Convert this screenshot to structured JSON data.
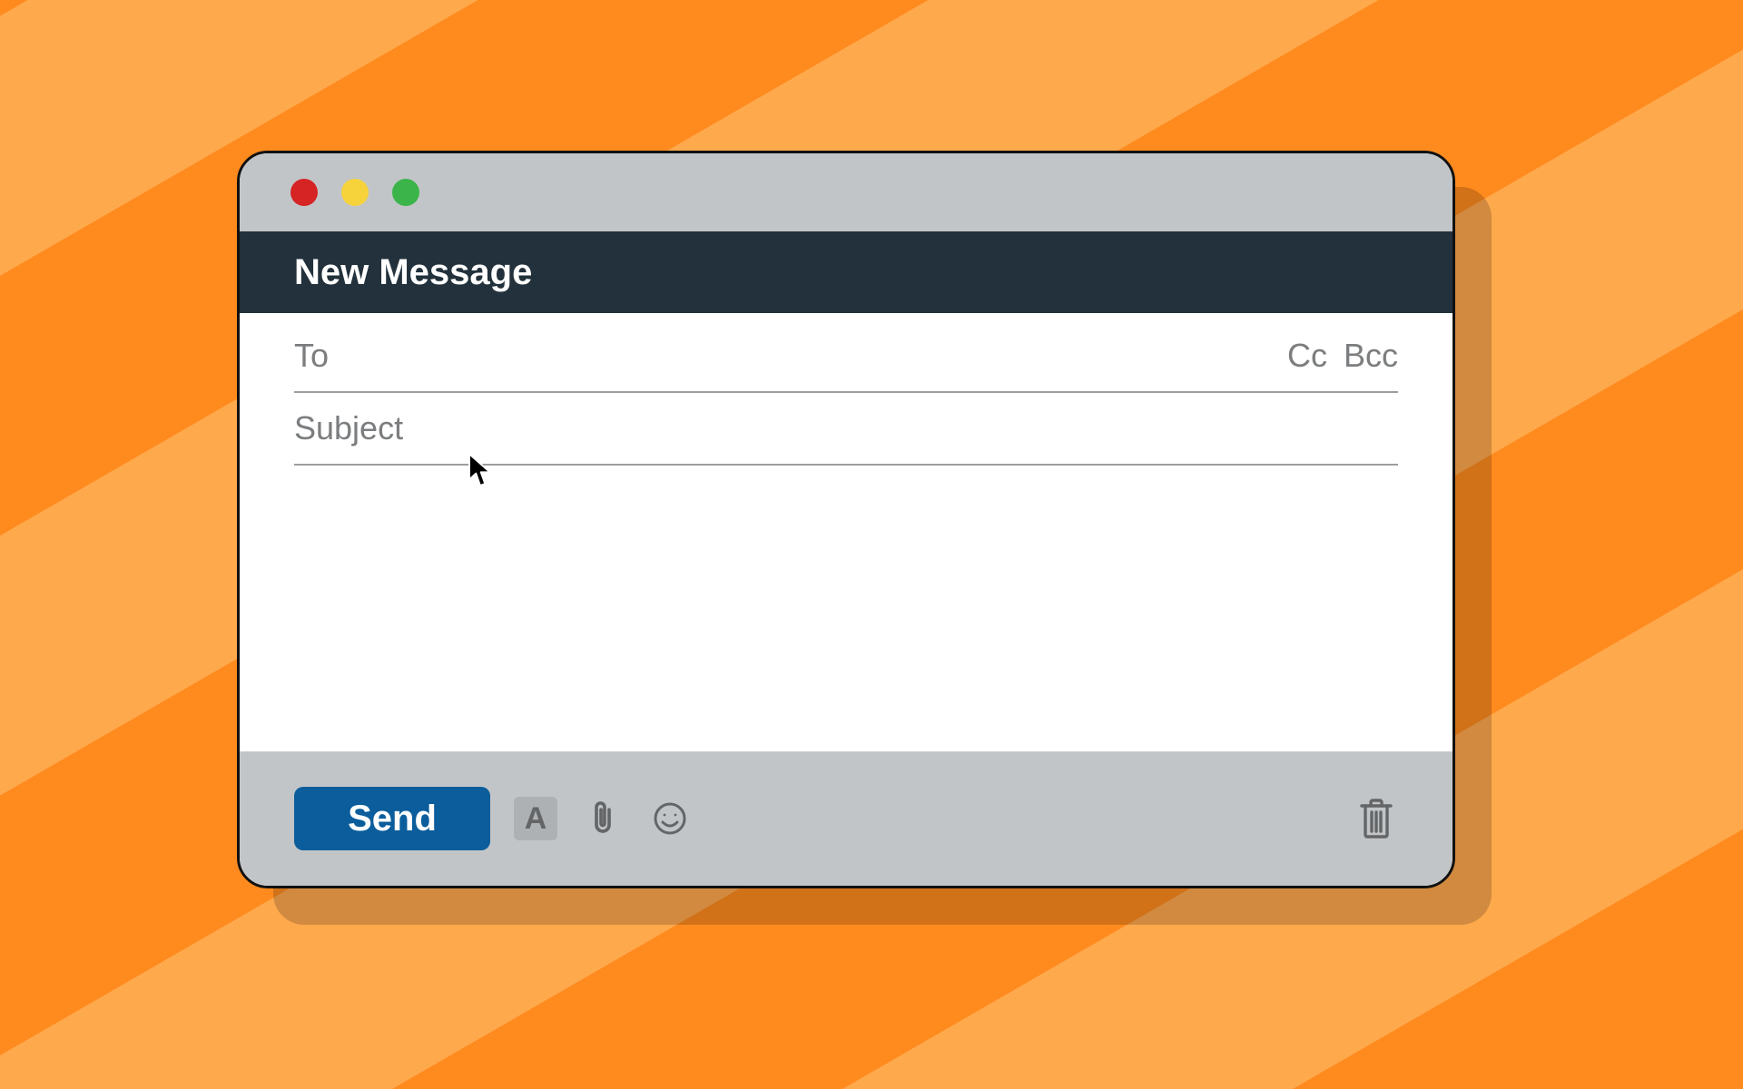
{
  "header": {
    "title": "New Message"
  },
  "fields": {
    "to_label": "To",
    "cc_label": "Cc",
    "bcc_label": "Bcc",
    "subject_label": "Subject"
  },
  "footer": {
    "send_label": "Send",
    "format_glyph": "A"
  }
}
